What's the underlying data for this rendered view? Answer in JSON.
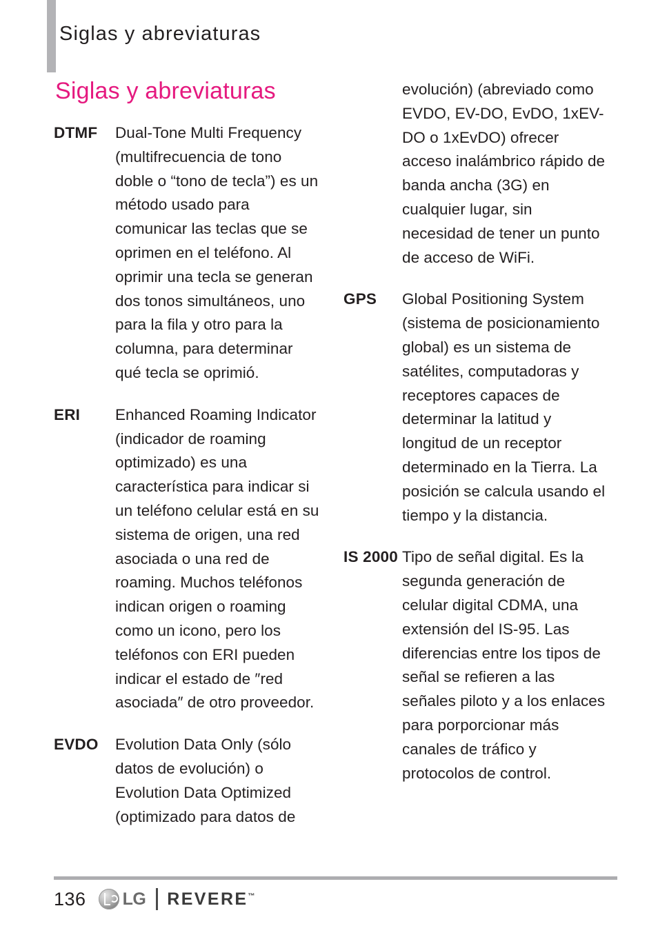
{
  "header": {
    "running_title": "Siglas y abreviaturas",
    "accent_bar_color": "#b3b3b6"
  },
  "heading": {
    "text": "Siglas y abreviaturas",
    "color": "#e5197f"
  },
  "left_column": {
    "entries": [
      {
        "term": "DTMF",
        "definition": "Dual-Tone Multi Frequency (multifrecuencia de tono doble o “tono de tecla”) es un método usado para comunicar las teclas que se oprimen en el teléfono. Al oprimir una tecla se generan dos tonos simultáneos, uno para la fila y otro para la columna, para determinar qué tecla se oprimió."
      },
      {
        "term": "ERI",
        "definition": "Enhanced Roaming Indicator (indicador de roaming optimizado) es una característica para indicar si un teléfono celular está en su sistema de origen, una red asociada o una red de roaming. Muchos teléfonos indican origen o roaming como un icono, pero los teléfonos con ERI pueden indicar el estado de ″red asociada″ de otro proveedor."
      },
      {
        "term": "EVDO",
        "definition": "Evolution Data Only (sólo datos de evolución) o Evolution Data Optimized (optimizado para datos de"
      }
    ]
  },
  "right_column": {
    "continuation": "evolución) (abreviado como EVDO, EV-DO, EvDO, 1xEV-DO o 1xEvDO) ofrecer acceso inalámbrico rápido de banda ancha (3G) en cualquier lugar, sin necesidad de tener un punto de acceso de WiFi.",
    "entries": [
      {
        "term": "GPS",
        "definition": "Global Positioning System (sistema de posicionamiento global) es un sistema de satélites, computadoras y receptores capaces de determinar la latitud y longitud de un receptor determinado en la Tierra. La posición se calcula usando el tiempo y la distancia."
      },
      {
        "term": "IS 2000",
        "definition": "Tipo de señal digital. Es la segunda generación de celular digital CDMA, una extensión del IS-95. Las diferencias entre los tipos de señal se refieren a las señales piloto y a los enlaces para porporcionar más canales de tráfico y protocolos de control."
      }
    ]
  },
  "footer": {
    "page_number": "136",
    "brand_lg": "LG",
    "brand_product": "REVERE",
    "trademark": "™",
    "rule_color": "#adadb0"
  }
}
